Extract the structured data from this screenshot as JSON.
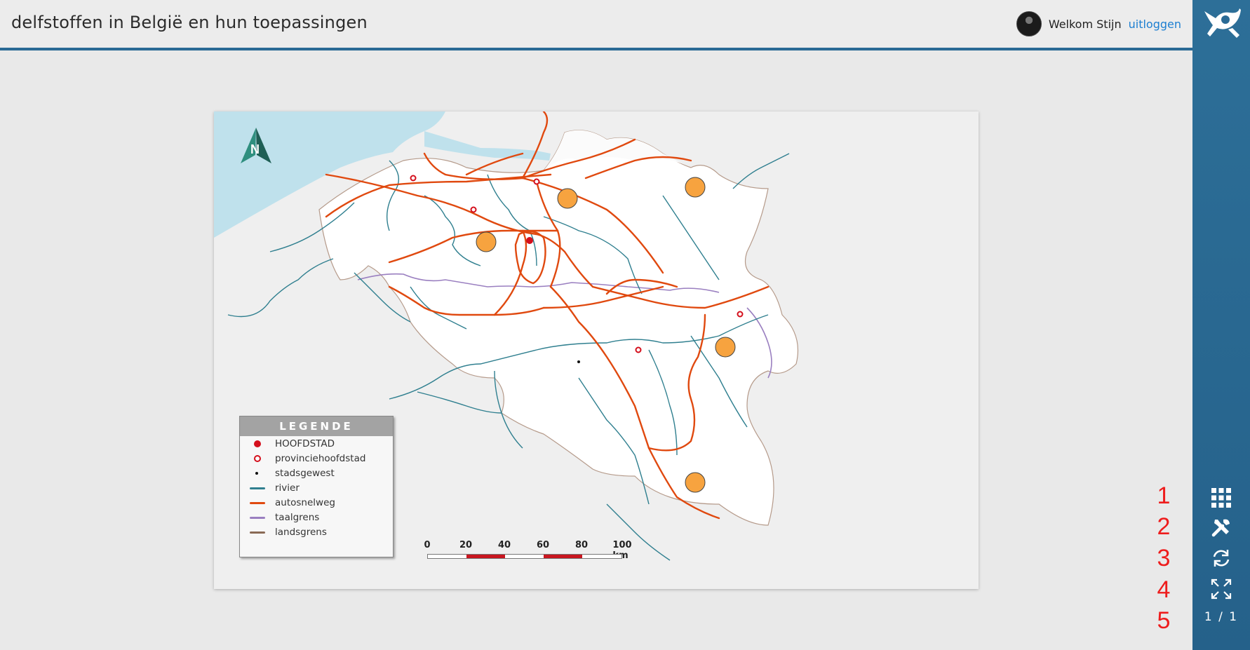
{
  "header": {
    "title": "delfstoffen in België en hun toepassingen",
    "welcome": "Welkom Stijn",
    "logout": "uitloggen"
  },
  "sidebar": {
    "buttons": [
      {
        "name": "grid-icon"
      },
      {
        "name": "tools-icon"
      },
      {
        "name": "refresh-icon"
      },
      {
        "name": "fullscreen-icon"
      }
    ],
    "page_counter": "1 / 1"
  },
  "annotations": [
    "1",
    "2",
    "3",
    "4",
    "5"
  ],
  "map": {
    "north_label": "N",
    "legend": {
      "title": "LEGENDE",
      "items": [
        {
          "label": "HOOFDSTAD",
          "symbol": "dot-red"
        },
        {
          "label": "provinciehoofdstad",
          "symbol": "ring-red"
        },
        {
          "label": "stadsgewest",
          "symbol": "dot-black"
        },
        {
          "label": "rivier",
          "symbol": "line-teal"
        },
        {
          "label": "autosnelweg",
          "symbol": "line-orange"
        },
        {
          "label": "taalgrens",
          "symbol": "line-purple"
        },
        {
          "label": "landsgrens",
          "symbol": "line-brown"
        }
      ]
    },
    "scale": {
      "labels": [
        "0",
        "20",
        "40",
        "60",
        "80",
        "100 km"
      ]
    },
    "colors": {
      "sea": "#bfe1ec",
      "land": "#ffffff",
      "river": "#2f7f8f",
      "motorway": "#e0490f",
      "language_border": "#9a7fc0",
      "country_border": "#a08070",
      "marker": "#f7a33f",
      "capital": "#d40f1c",
      "sidebar": "#2a6a95",
      "link": "#1d7fd1",
      "annotation": "#ee1d1d"
    }
  }
}
